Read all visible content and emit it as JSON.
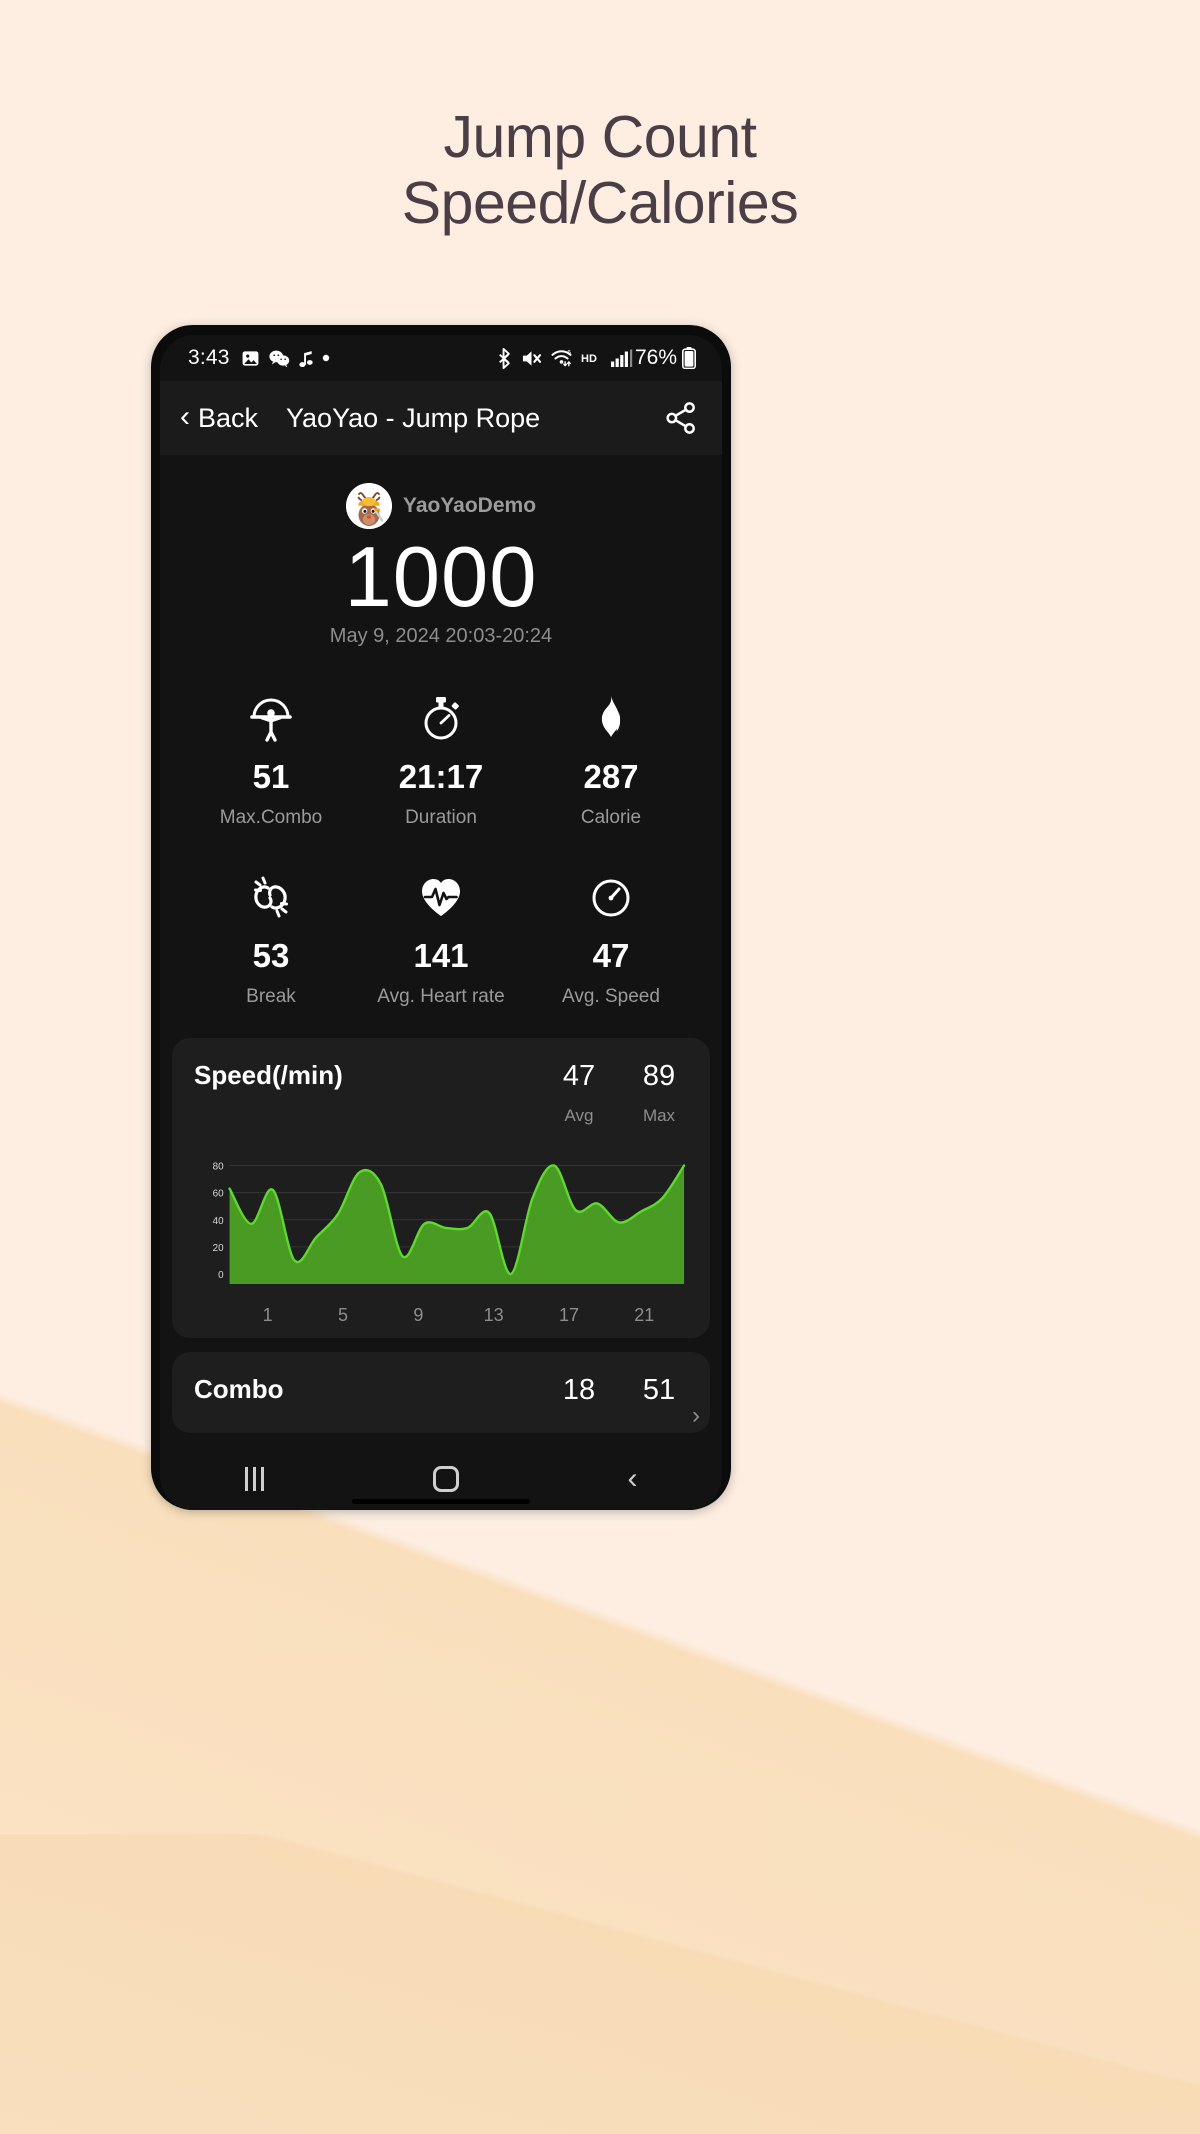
{
  "promo": {
    "headline_line1": "Jump Count",
    "headline_line2": "Speed/Calories",
    "bg_color": "#fdeee1",
    "text_color": "#4b3f47"
  },
  "status_bar": {
    "time": "3:43",
    "left_icons": [
      "photo-icon",
      "wechat-icon",
      "music-note-icon",
      "dot-icon"
    ],
    "right_icons": [
      "bluetooth-icon",
      "mute-icon",
      "wifi6-icon",
      "hd-icon",
      "signal-icon"
    ],
    "battery_percent": "76%"
  },
  "nav": {
    "back_label": "Back",
    "title": "YaoYao - Jump Rope",
    "share_icon": "share-icon"
  },
  "hero": {
    "username": "YaoYaoDemo",
    "count": "1000",
    "date_range": "May 9, 2024 20:03-20:24"
  },
  "stats": [
    {
      "icon": "jump-rope-icon",
      "value": "51",
      "label": "Max.Combo"
    },
    {
      "icon": "stopwatch-icon",
      "value": "21:17",
      "label": "Duration"
    },
    {
      "icon": "flame-icon",
      "value": "287",
      "label": "Calorie"
    },
    {
      "icon": "break-rope-icon",
      "value": "53",
      "label": "Break"
    },
    {
      "icon": "heart-pulse-icon",
      "value": "141",
      "label": "Avg. Heart rate"
    },
    {
      "icon": "speedometer-icon",
      "value": "47",
      "label": "Avg. Speed"
    }
  ],
  "speed_card": {
    "title": "Speed(/min)",
    "avg_value": "47",
    "avg_label": "Avg",
    "max_value": "89",
    "max_label": "Max",
    "line_color": "#5ed92e",
    "fill_color": "#4a9b23"
  },
  "combo_card": {
    "title": "Combo",
    "left_value": "18",
    "right_value": "51",
    "chevron": "chevron-right-icon"
  },
  "android_nav": {
    "recent_icon": "recent-apps-icon",
    "home_icon": "home-icon",
    "back_icon": "back-icon"
  },
  "chart_data": {
    "type": "area",
    "title": "Speed(/min)",
    "xlabel": "",
    "ylabel": "",
    "ylim": [
      0,
      90
    ],
    "xlim": [
      1,
      22
    ],
    "grid": true,
    "legend": "none",
    "ytick_labels": [
      "80",
      "60",
      "40",
      "20",
      "0"
    ],
    "yticks": [
      80,
      60,
      40,
      20,
      0
    ],
    "xtick_labels": [
      "1",
      "5",
      "9",
      "13",
      "17",
      "21"
    ],
    "xticks": [
      1,
      5,
      9,
      13,
      17,
      21
    ],
    "x": [
      1,
      2,
      3,
      4,
      5,
      6,
      7,
      8,
      9,
      10,
      11,
      12,
      13,
      14,
      15,
      16,
      17,
      18,
      19,
      20,
      21,
      22
    ],
    "values": [
      63,
      37,
      62,
      10,
      27,
      44,
      75,
      66,
      13,
      37,
      34,
      34,
      45,
      0,
      56,
      80,
      47,
      52,
      38,
      46,
      56,
      80
    ],
    "series": [
      {
        "name": "Speed",
        "values": [
          63,
          37,
          62,
          10,
          27,
          44,
          75,
          66,
          13,
          37,
          34,
          34,
          45,
          0,
          56,
          80,
          47,
          52,
          38,
          46,
          56,
          80
        ]
      }
    ]
  }
}
